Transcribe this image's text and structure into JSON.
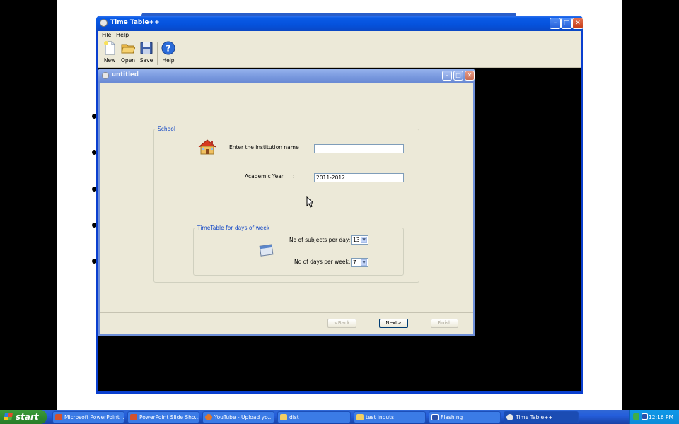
{
  "main_window": {
    "title": "Time Table++",
    "menu": [
      {
        "label": "File"
      },
      {
        "label": "Help"
      }
    ],
    "toolbar": [
      {
        "label": "New",
        "icon": "new-document-icon"
      },
      {
        "label": "Open",
        "icon": "open-folder-icon"
      },
      {
        "label": "Save",
        "icon": "save-disk-icon"
      },
      {
        "label": "Help",
        "icon": "help-icon"
      }
    ]
  },
  "child_window": {
    "title": "untitled",
    "school_group": {
      "legend": "School",
      "institution_label": "Enter the institution name",
      "institution_colon": ":",
      "institution_value": "",
      "year_label": "Academic Year",
      "year_colon": ":",
      "year_value": "2011-2012"
    },
    "week_group": {
      "legend": "TimeTable for days of week",
      "subjects_label": "No of subjects per day:",
      "subjects_value": "13",
      "days_label": "No of days per week:",
      "days_value": "7"
    },
    "buttons": {
      "back": "<Back",
      "next": "Next>",
      "finish": "Finish"
    }
  },
  "taskbar": {
    "start_label": "start",
    "tasks": [
      {
        "label": "Microsoft PowerPoint ..."
      },
      {
        "label": "PowerPoint Slide Sho..."
      },
      {
        "label": "YouTube - Upload yo..."
      },
      {
        "label": "dist"
      },
      {
        "label": "test inputs"
      },
      {
        "label": "Flashing"
      },
      {
        "label": "Time Table++"
      }
    ],
    "clock": "12:16 PM"
  },
  "colors": {
    "titlebar_blue": "#0552dc",
    "window_face": "#ece9d8",
    "legend_blue": "#1448c6",
    "start_green": "#2f8a2f"
  }
}
